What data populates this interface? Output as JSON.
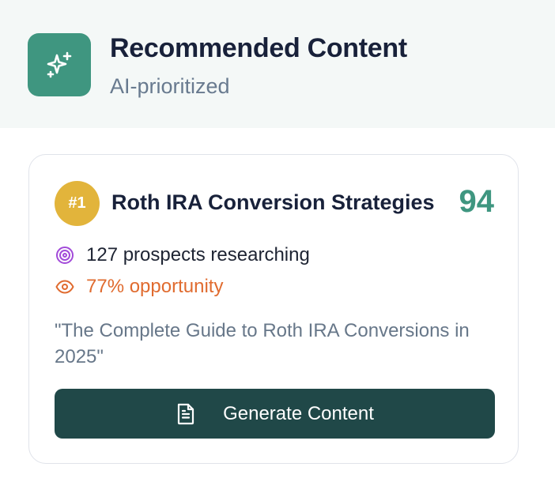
{
  "header": {
    "title": "Recommended Content",
    "subtitle": "AI-prioritized",
    "icon": "sparkles-icon",
    "icon_bg": "#3f9680"
  },
  "card": {
    "rank": "#1",
    "topic": "Roth IRA Conversion Strategies",
    "score": "94",
    "prospects": "127 prospects researching",
    "prospects_icon": "target-icon",
    "opportunity": "77% opportunity",
    "opportunity_icon": "eye-icon",
    "quote": "\"The Complete Guide to Roth IRA Conversions in 2025\"",
    "button_label": "Generate Content",
    "button_icon": "document-icon"
  },
  "colors": {
    "accent": "#3f9680",
    "rank_badge": "#e2b43b",
    "opportunity": "#e06b2f",
    "target": "#a24ad9",
    "button": "#204848"
  }
}
